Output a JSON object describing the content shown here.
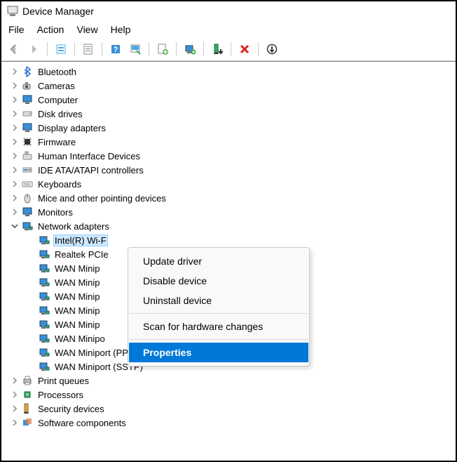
{
  "window": {
    "title": "Device Manager"
  },
  "menubar": {
    "file": "File",
    "action": "Action",
    "view": "View",
    "help": "Help"
  },
  "toolbar_icons": {
    "back": "back-arrow",
    "forward": "forward-arrow",
    "show_hidden": "show-hidden",
    "properties": "properties-sheet",
    "help": "help",
    "scan": "scan-hardware",
    "update_drv": "update-driver",
    "add_legacy": "add-legacy",
    "uninstall": "uninstall",
    "disable": "disable",
    "enable": "enable"
  },
  "tree": {
    "categories": [
      {
        "label": "Bluetooth",
        "icon": "bluetooth",
        "expanded": false
      },
      {
        "label": "Cameras",
        "icon": "camera",
        "expanded": false
      },
      {
        "label": "Computer",
        "icon": "monitor",
        "expanded": false
      },
      {
        "label": "Disk drives",
        "icon": "disk",
        "expanded": false
      },
      {
        "label": "Display adapters",
        "icon": "monitor",
        "expanded": false
      },
      {
        "label": "Firmware",
        "icon": "chip",
        "expanded": false
      },
      {
        "label": "Human Interface Devices",
        "icon": "hid",
        "expanded": false
      },
      {
        "label": "IDE ATA/ATAPI controllers",
        "icon": "ide",
        "expanded": false
      },
      {
        "label": "Keyboards",
        "icon": "keyboard",
        "expanded": false
      },
      {
        "label": "Mice and other pointing devices",
        "icon": "mouse",
        "expanded": false
      },
      {
        "label": "Monitors",
        "icon": "monitor",
        "expanded": false
      },
      {
        "label": "Network adapters",
        "icon": "netadapter",
        "expanded": true,
        "children": [
          {
            "label": "Intel(R) Wi-F",
            "selected": true,
            "truncated": true
          },
          {
            "label": "Realtek PCIe",
            "truncated": true
          },
          {
            "label": "WAN Minip",
            "truncated": true
          },
          {
            "label": "WAN Minip",
            "truncated": true
          },
          {
            "label": "WAN Minip",
            "truncated": true
          },
          {
            "label": "WAN Minip",
            "truncated": true
          },
          {
            "label": "WAN Minip",
            "truncated": true
          },
          {
            "label": "WAN Minipo",
            "truncated": true
          },
          {
            "label": "WAN Miniport (PPTP)"
          },
          {
            "label": "WAN Miniport (SSTP)"
          }
        ]
      },
      {
        "label": "Print queues",
        "icon": "printer",
        "expanded": false
      },
      {
        "label": "Processors",
        "icon": "cpu",
        "expanded": false
      },
      {
        "label": "Security devices",
        "icon": "security",
        "expanded": false
      },
      {
        "label": "Software components",
        "icon": "software",
        "expanded": false,
        "cutoff": true
      }
    ]
  },
  "context_menu": {
    "items": [
      {
        "label": "Update driver"
      },
      {
        "label": "Disable device"
      },
      {
        "label": "Uninstall device"
      }
    ],
    "items2": [
      {
        "label": "Scan for hardware changes"
      }
    ],
    "items3": [
      {
        "label": "Properties",
        "highlighted": true
      }
    ]
  }
}
